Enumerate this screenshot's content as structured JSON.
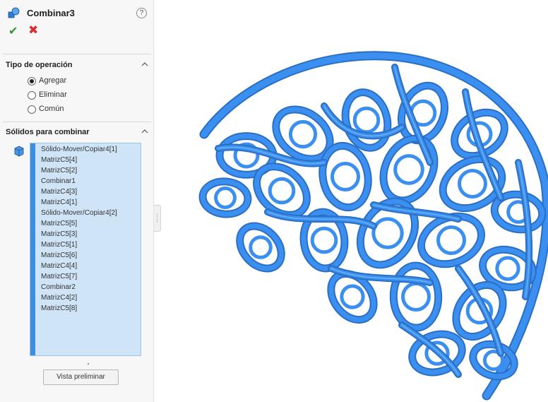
{
  "property_manager": {
    "title": "Combinar3",
    "help_label": "?",
    "ok_glyph": "✔",
    "cancel_glyph": "✖",
    "feature_icon": "combine-icon",
    "accent_color": "#3d8fdd"
  },
  "operation_type": {
    "title": "Tipo de operación",
    "options": [
      {
        "label": "Agregar",
        "selected": true
      },
      {
        "label": "Eliminar",
        "selected": false
      },
      {
        "label": "Común",
        "selected": false
      }
    ]
  },
  "bodies_to_combine": {
    "title": "Sólidos para combinar",
    "items": [
      "Sólido-Mover/Copiar4[1]",
      "MatrizC5[4]",
      "MatrizC5[2]",
      "Combinar1",
      "MatrizC4[3]",
      "MatrizC4[1]",
      "Sólido-Mover/Copiar4[2]",
      "MatrizC5[5]",
      "MatrizC5[3]",
      "MatrizC5[1]",
      "MatrizC5[6]",
      "MatrizC4[4]",
      "MatrizC5[7]",
      "Combinar2",
      "MatrizC4[2]",
      "MatrizC5[8]"
    ]
  },
  "preview_button": {
    "label": "Vista preliminar"
  },
  "model": {
    "color": "#3b8ff0",
    "shade_color": "#2a6fc4",
    "highlight_color": "#7fc0ff"
  }
}
